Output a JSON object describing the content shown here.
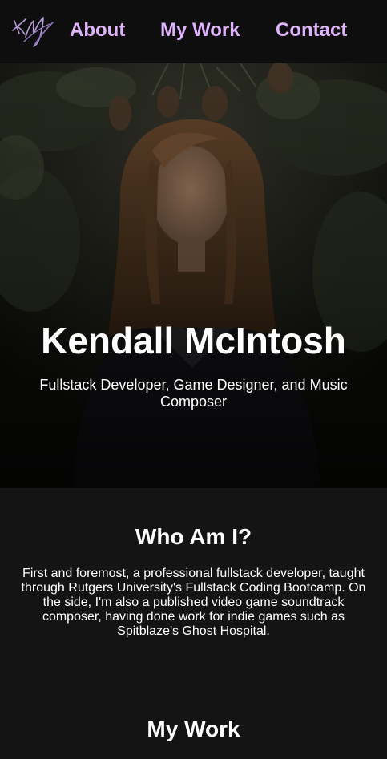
{
  "nav": {
    "logo": "KM",
    "links": [
      {
        "label": "About"
      },
      {
        "label": "My Work"
      },
      {
        "label": "Contact"
      }
    ]
  },
  "hero": {
    "name": "Kendall McIntosh",
    "tagline": "Fullstack Developer, Game Designer, and Music Composer"
  },
  "about": {
    "title": "Who Am I?",
    "text": "First and foremost, a professional fullstack developer, taught through Rutgers University's Fullstack Coding Bootcamp. On the side, I'm also a published video game soundtrack composer, having done work for indie games such as Spitblaze's Ghost Hospital."
  },
  "work": {
    "title": "My Work"
  },
  "colors": {
    "accent": "#e0b3ff",
    "nav_background": "#0e0e0e",
    "page_background": "#141414",
    "text": "#ffffff"
  }
}
